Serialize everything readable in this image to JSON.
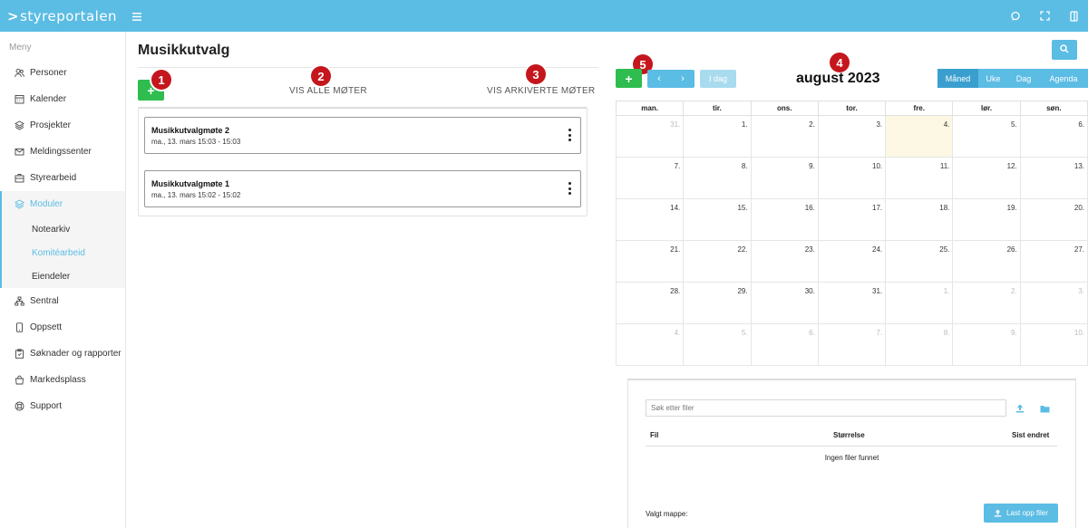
{
  "app": {
    "logo_text": "styreportalen",
    "logo_chevron": ">"
  },
  "sidebar": {
    "menu_label": "Meny",
    "items": [
      {
        "label": "Personer",
        "icon": "users-icon"
      },
      {
        "label": "Kalender",
        "icon": "calendar-icon"
      },
      {
        "label": "Prosjekter",
        "icon": "layers-icon"
      },
      {
        "label": "Meldingssenter",
        "icon": "envelope-icon"
      },
      {
        "label": "Styrearbeid",
        "icon": "briefcase-icon"
      },
      {
        "label": "Moduler",
        "icon": "layers-icon",
        "active": true
      },
      {
        "label": "Sentral",
        "icon": "sitemap-icon"
      },
      {
        "label": "Oppsett",
        "icon": "mobile-icon"
      },
      {
        "label": "Søknader og rapporter",
        "icon": "clipboard-icon"
      },
      {
        "label": "Markedsplass",
        "icon": "shopping-bag-icon"
      },
      {
        "label": "Support",
        "icon": "lifebuoy-icon"
      }
    ],
    "sub_items": [
      {
        "label": "Notearkiv",
        "active": false
      },
      {
        "label": "Komitéarbeid",
        "active": true
      },
      {
        "label": "Eiendeler",
        "active": false
      }
    ]
  },
  "main": {
    "title": "Musikkutvalg",
    "add_label": "+",
    "tabs": {
      "all": "VIS ALLE MØTER",
      "archived": "VIS ARKIVERTE MØTER"
    },
    "meetings": [
      {
        "name": "Musikkutvalgmøte 2",
        "time": "ma., 13. mars 15:03 - 15:03"
      },
      {
        "name": "Musikkutvalgmøte 1",
        "time": "ma., 13. mars 15:02 - 15:02"
      }
    ]
  },
  "markers": [
    "1",
    "2",
    "3",
    "4",
    "5"
  ],
  "calendar": {
    "add_label": "+",
    "prev_label": "‹",
    "next_label": "›",
    "today_label": "I dag",
    "title": "august 2023",
    "views": [
      {
        "label": "Måned",
        "active": true
      },
      {
        "label": "Uke",
        "active": false
      },
      {
        "label": "Dag",
        "active": false
      },
      {
        "label": "Agenda",
        "active": false
      }
    ],
    "weekdays": [
      "man.",
      "tir.",
      "ons.",
      "tor.",
      "fre.",
      "lør.",
      "søn."
    ],
    "weeks": [
      [
        {
          "d": "31.",
          "o": true
        },
        {
          "d": "1."
        },
        {
          "d": "2."
        },
        {
          "d": "3."
        },
        {
          "d": "4.",
          "t": true
        },
        {
          "d": "5."
        },
        {
          "d": "6."
        }
      ],
      [
        {
          "d": "7."
        },
        {
          "d": "8."
        },
        {
          "d": "9."
        },
        {
          "d": "10."
        },
        {
          "d": "11."
        },
        {
          "d": "12."
        },
        {
          "d": "13."
        }
      ],
      [
        {
          "d": "14."
        },
        {
          "d": "15."
        },
        {
          "d": "16."
        },
        {
          "d": "17."
        },
        {
          "d": "18."
        },
        {
          "d": "19."
        },
        {
          "d": "20."
        }
      ],
      [
        {
          "d": "21."
        },
        {
          "d": "22."
        },
        {
          "d": "23."
        },
        {
          "d": "24."
        },
        {
          "d": "25."
        },
        {
          "d": "26."
        },
        {
          "d": "27."
        }
      ],
      [
        {
          "d": "28."
        },
        {
          "d": "29."
        },
        {
          "d": "30."
        },
        {
          "d": "31."
        },
        {
          "d": "1.",
          "o": true
        },
        {
          "d": "2.",
          "o": true
        },
        {
          "d": "3.",
          "o": true
        }
      ],
      [
        {
          "d": "4.",
          "o": true
        },
        {
          "d": "5.",
          "o": true
        },
        {
          "d": "6.",
          "o": true
        },
        {
          "d": "7.",
          "o": true
        },
        {
          "d": "8.",
          "o": true
        },
        {
          "d": "9.",
          "o": true
        },
        {
          "d": "10.",
          "o": true
        }
      ]
    ]
  },
  "files": {
    "search_placeholder": "Søk etter filer",
    "col_file": "Fil",
    "col_size": "Størrelse",
    "col_modified": "Sist endret",
    "empty_text": "Ingen filer funnet",
    "selected_folder_label": "Valgt mappe:",
    "upload_label": "Last opp filer"
  },
  "colors": {
    "accent": "#5bbce4",
    "green": "#2ebd4e",
    "marker": "#c5161d",
    "today": "#fcf8e3"
  }
}
